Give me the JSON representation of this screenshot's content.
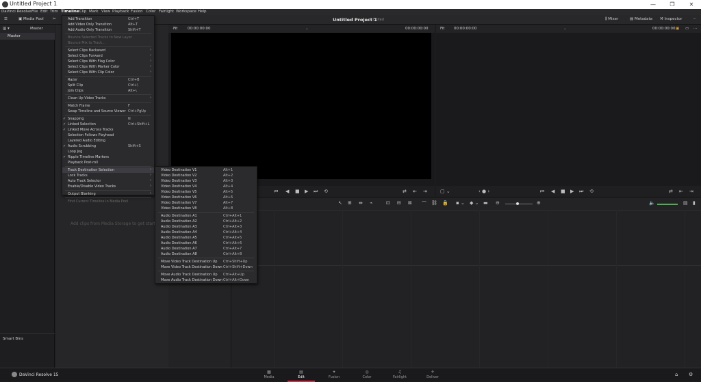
{
  "window": {
    "title": "Untitled Project 1",
    "min": "—",
    "max": "❐",
    "close": "✕"
  },
  "menubar": [
    "DaVinci Resolve",
    "File",
    "Edit",
    "Trim",
    "Timeline",
    "Clip",
    "Mark",
    "View",
    "Playback",
    "Fusion",
    "Color",
    "Fairlight",
    "Workspace",
    "Help"
  ],
  "toolbar": {
    "media_pool": "Media Pool",
    "project_name": "Untitled Project 1",
    "edited": "Edited",
    "mixer": "Mixer",
    "metadata": "Metadata",
    "inspector": "Inspector"
  },
  "bins": {
    "master": "Master",
    "master_item": "Master",
    "smart_bins": "Smart Bins"
  },
  "media_pool": {
    "empty_text": "Add clips from Media Storage to get started"
  },
  "source_viewer": {
    "zoom": "Fit",
    "timecode_left": "00:00:00:00",
    "timecode_right": "00:00:00:00"
  },
  "record_viewer": {
    "zoom": "Fit",
    "timecode_left": "00:00:00:00",
    "timecode_right": "00:00:00:00"
  },
  "timeline_menu": {
    "items": [
      {
        "label": "Add Transition",
        "shortcut": "Ctrl+T"
      },
      {
        "label": "Add Video Only Transition",
        "shortcut": "Alt+T"
      },
      {
        "label": "Add Audio Only Transition",
        "shortcut": "Shift+T"
      },
      {
        "sep": true
      },
      {
        "label": "Bounce Selected Tracks to New Layer",
        "disabled": true
      },
      {
        "label": "Bounce Mix to Track...",
        "disabled": true
      },
      {
        "sep": true
      },
      {
        "label": "Select Clips Backward",
        "arrow": true
      },
      {
        "label": "Select Clips Forward",
        "arrow": true
      },
      {
        "label": "Select Clips With Flag Color",
        "arrow": true
      },
      {
        "label": "Select Clips With Marker Color",
        "arrow": true
      },
      {
        "label": "Select Clips With Clip Color",
        "arrow": true
      },
      {
        "sep": true
      },
      {
        "label": "Razor",
        "shortcut": "Ctrl+B"
      },
      {
        "label": "Split Clip",
        "shortcut": "Ctrl+\\"
      },
      {
        "label": "Join Clips",
        "shortcut": "Alt+\\"
      },
      {
        "sep": true
      },
      {
        "label": "Clean Up Video Tracks",
        "arrow": true
      },
      {
        "sep": true
      },
      {
        "label": "Match Frame",
        "shortcut": "F"
      },
      {
        "label": "Swap Timeline and Source Viewer",
        "shortcut": "Ctrl+PgUp"
      },
      {
        "sep": true
      },
      {
        "label": "Snapping",
        "shortcut": "N",
        "checked": true
      },
      {
        "label": "Linked Selection",
        "shortcut": "Ctrl+Shift+L",
        "checked": true
      },
      {
        "label": "Linked Move Across Tracks",
        "checked": true
      },
      {
        "label": "Selection Follows Playhead"
      },
      {
        "label": "Layered Audio Editing"
      },
      {
        "label": "Audio Scrubbing",
        "shortcut": "Shift+S",
        "checked": true
      },
      {
        "label": "Loop Jog"
      },
      {
        "label": "Ripple Timeline Markers",
        "checked": true
      },
      {
        "label": "Playback Post-roll"
      },
      {
        "sep": true
      },
      {
        "label": "Track Destination Selection",
        "arrow": true,
        "highlighted": true
      },
      {
        "label": "Lock Tracks",
        "arrow": true
      },
      {
        "label": "Auto Track Selector",
        "arrow": true
      },
      {
        "label": "Enable/Disable Video Tracks",
        "arrow": true
      },
      {
        "sep": true
      },
      {
        "label": "Output Blanking",
        "arrow": true
      },
      {
        "sep": true
      },
      {
        "label": "Find Current Timeline in Media Pool",
        "disabled": true
      }
    ]
  },
  "tds_menu": {
    "items": [
      {
        "label": "Video Destination V1",
        "shortcut": "Alt+1"
      },
      {
        "label": "Video Destination V2",
        "shortcut": "Alt+2"
      },
      {
        "label": "Video Destination V3",
        "shortcut": "Alt+3"
      },
      {
        "label": "Video Destination V4",
        "shortcut": "Alt+4"
      },
      {
        "label": "Video Destination V5",
        "shortcut": "Alt+5"
      },
      {
        "label": "Video Destination V6",
        "shortcut": "Alt+6"
      },
      {
        "label": "Video Destination V7",
        "shortcut": "Alt+7"
      },
      {
        "label": "Video Destination V8",
        "shortcut": "Alt+8"
      },
      {
        "sep": true
      },
      {
        "label": "Audio Destination A1",
        "shortcut": "Ctrl+Alt+1"
      },
      {
        "label": "Audio Destination A2",
        "shortcut": "Ctrl+Alt+2"
      },
      {
        "label": "Audio Destination A3",
        "shortcut": "Ctrl+Alt+3"
      },
      {
        "label": "Audio Destination A4",
        "shortcut": "Ctrl+Alt+4"
      },
      {
        "label": "Audio Destination A5",
        "shortcut": "Ctrl+Alt+5"
      },
      {
        "label": "Audio Destination A6",
        "shortcut": "Ctrl+Alt+6"
      },
      {
        "label": "Audio Destination A7",
        "shortcut": "Ctrl+Alt+7"
      },
      {
        "label": "Audio Destination A8",
        "shortcut": "Ctrl+Alt+8"
      },
      {
        "sep": true
      },
      {
        "label": "Move Video Track Destination Up",
        "shortcut": "Ctrl+Shift+Up"
      },
      {
        "label": "Move Video Track Destination Down",
        "shortcut": "Ctrl+Shift+Down"
      },
      {
        "sep": true
      },
      {
        "label": "Move Audio Track Destination Up",
        "shortcut": "Ctrl+Alt+Up"
      },
      {
        "label": "Move Audio Track Destination Down",
        "shortcut": "Ctrl+Alt+Down"
      }
    ]
  },
  "bottom": {
    "brand": "DaVinci Resolve 15",
    "pages": [
      {
        "label": "Media",
        "icon": "media-page-icon"
      },
      {
        "label": "Edit",
        "icon": "edit-page-icon",
        "active": true
      },
      {
        "label": "Fusion",
        "icon": "fusion-page-icon"
      },
      {
        "label": "Color",
        "icon": "color-page-icon"
      },
      {
        "label": "Fairlight",
        "icon": "fairlight-page-icon"
      },
      {
        "label": "Deliver",
        "icon": "deliver-page-icon"
      }
    ]
  },
  "colors": {
    "accent": "#d0314a",
    "bg": "#1c1c1e"
  }
}
